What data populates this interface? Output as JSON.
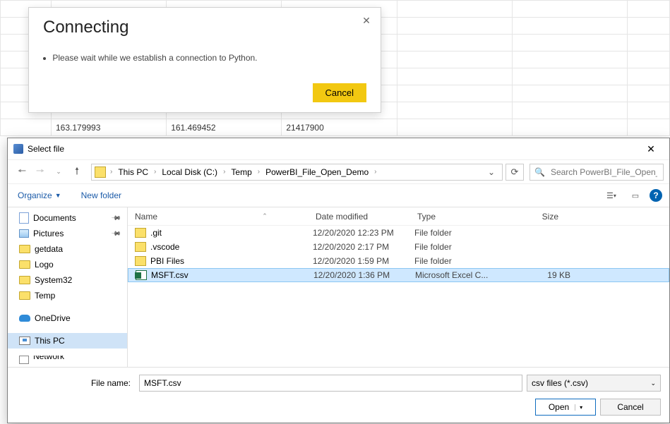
{
  "background_grid": {
    "row_visible": [
      "163.179993",
      "161.469452",
      "21417900"
    ]
  },
  "connecting": {
    "title": "Connecting",
    "message": "Please wait while we establish a connection to Python.",
    "cancel_label": "Cancel"
  },
  "file_dialog": {
    "title": "Select file",
    "breadcrumb": [
      "This PC",
      "Local Disk (C:)",
      "Temp",
      "PowerBI_File_Open_Demo"
    ],
    "search_placeholder": "Search PowerBI_File_Open_D...",
    "toolbar": {
      "organize": "Organize",
      "new_folder": "New folder"
    },
    "tree": [
      {
        "name": "Documents",
        "icon": "doc",
        "pinned": true
      },
      {
        "name": "Pictures",
        "icon": "pic",
        "pinned": true
      },
      {
        "name": "getdata",
        "icon": "folder"
      },
      {
        "name": "Logo",
        "icon": "folder"
      },
      {
        "name": "System32",
        "icon": "folder"
      },
      {
        "name": "Temp",
        "icon": "folder"
      },
      {
        "spacer": true
      },
      {
        "name": "OneDrive",
        "icon": "onedrive"
      },
      {
        "spacer": true
      },
      {
        "name": "This PC",
        "icon": "pc",
        "selected": true
      },
      {
        "spacer": true
      },
      {
        "name": "N e t w o r k",
        "icon": "net",
        "cut": true
      }
    ],
    "columns": {
      "name": "Name",
      "date": "Date modified",
      "type": "Type",
      "size": "Size"
    },
    "rows": [
      {
        "name": ".git",
        "date": "12/20/2020 12:23 PM",
        "type": "File folder",
        "size": "",
        "icon": "folder"
      },
      {
        "name": ".vscode",
        "date": "12/20/2020 2:17 PM",
        "type": "File folder",
        "size": "",
        "icon": "folder"
      },
      {
        "name": "PBI Files",
        "date": "12/20/2020 1:59 PM",
        "type": "File folder",
        "size": "",
        "icon": "folder"
      },
      {
        "name": "MSFT.csv",
        "date": "12/20/2020 1:36 PM",
        "type": "Microsoft Excel C...",
        "size": "19 KB",
        "icon": "csv",
        "selected": true
      }
    ],
    "filename_label": "File name:",
    "filename_value": "MSFT.csv",
    "filter_label": "csv files (*.csv)",
    "open_label": "Open",
    "cancel_label": "Cancel"
  }
}
